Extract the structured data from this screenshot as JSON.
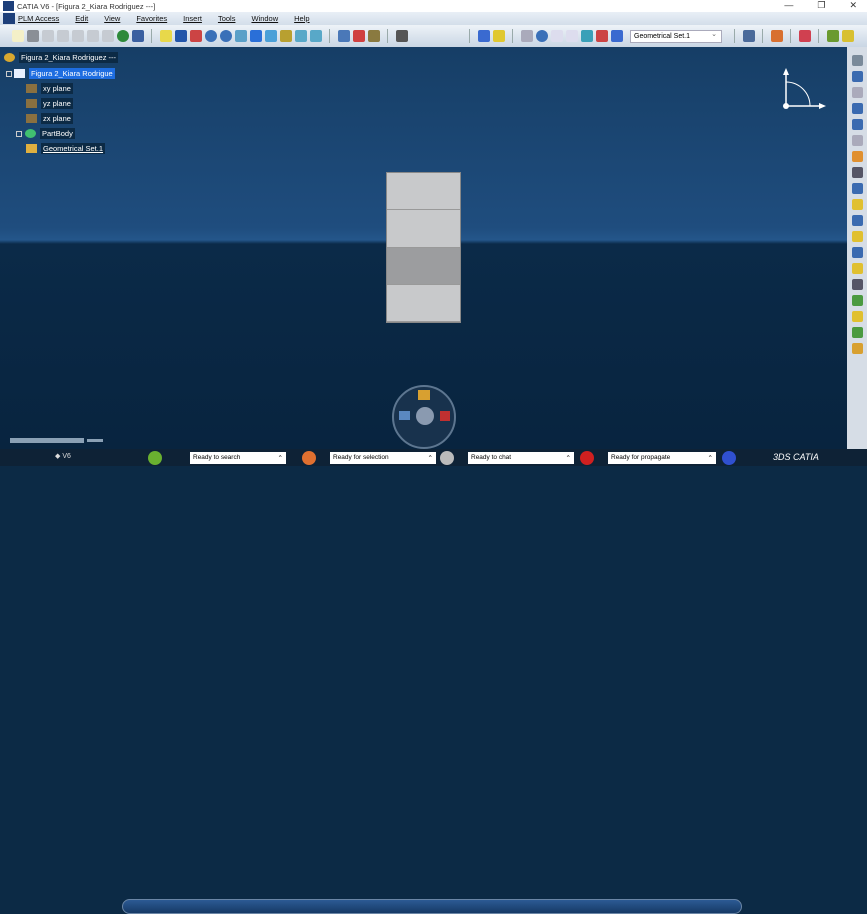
{
  "window": {
    "title": "CATIA V6 - [Figura 2_Kiara Rodriguez ---]",
    "controls": [
      "—",
      "❐",
      "✕"
    ]
  },
  "menu": [
    "PLM Access",
    "Edit",
    "View",
    "Favorites",
    "Insert",
    "Tools",
    "Window",
    "Help"
  ],
  "toolbar": {
    "geometry_dropdown": "Geometrical Set.1"
  },
  "tree": {
    "root": "Figura 2_Kiara Rodriguez ---",
    "part": "Figura 2_Kiara Rodrigue",
    "items": [
      "xy plane",
      "yz plane",
      "zx plane",
      "PartBody",
      "Geometrical Set.1"
    ]
  },
  "status": {
    "search": "Ready to search",
    "selection": "Ready for selection",
    "chat": "Ready to chat",
    "propagate": "Ready for propagate",
    "v6": "V6",
    "brand": "3DS CATIA"
  },
  "colors": {
    "selection": "#1e6de0",
    "viewport_top": "#1f4d7e",
    "viewport_bottom": "#0b2a48"
  }
}
